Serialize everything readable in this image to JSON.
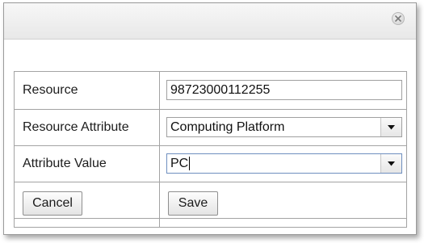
{
  "dialog": {
    "close_icon": "close-circle-icon"
  },
  "form": {
    "resource": {
      "label": "Resource",
      "value": "98723000112255"
    },
    "resource_attribute": {
      "label": "Resource Attribute",
      "value": "Computing Platform",
      "dropdown_icon": "triangle-down-icon"
    },
    "attribute_value": {
      "label": "Attribute Value",
      "value": "PC",
      "dropdown_icon": "triangle-down-icon"
    }
  },
  "buttons": {
    "cancel_label": "Cancel",
    "save_label": "Save"
  },
  "colors": {
    "border": "#a3a3a3",
    "titlebar": "#ececec",
    "focus_border": "#6f8fbf"
  }
}
